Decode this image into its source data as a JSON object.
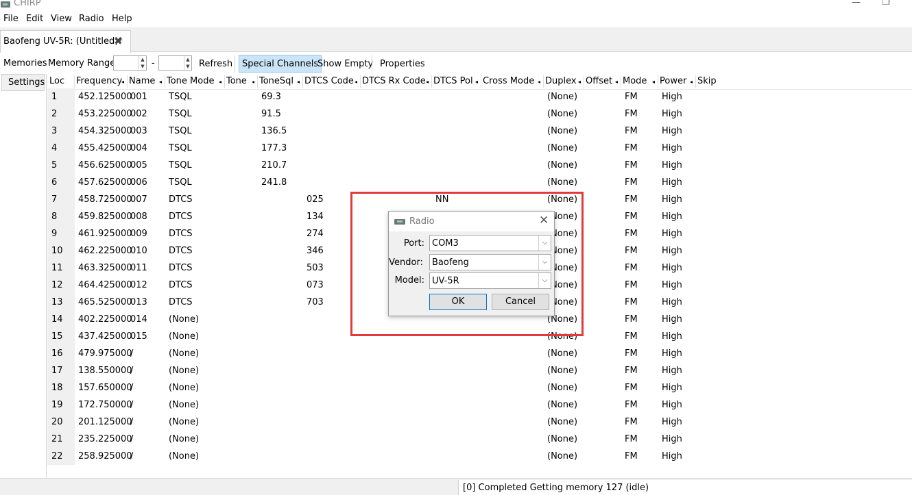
{
  "window": {
    "title": "CHIRP",
    "minimize_glyph": "—",
    "maximize_glyph": "❐"
  },
  "menu": [
    "File",
    "Edit",
    "View",
    "Radio",
    "Help"
  ],
  "tab": {
    "label": "Baofeng UV-5R: (Untitled)*",
    "close_glyph": "✖"
  },
  "toolbar": {
    "memories_label": "Memories",
    "range_label": "Memory Range:",
    "range_dash": "-",
    "range_from": "",
    "range_to": "",
    "refresh": "Refresh",
    "special_channels": "Special Channels",
    "show_empty": "Show Empty",
    "properties": "Properties"
  },
  "side_tab": "Settings",
  "columns": [
    "Loc",
    "Frequency",
    "Name",
    "Tone Mode",
    "Tone",
    "ToneSql",
    "DTCS Code",
    "DTCS Rx Code",
    "DTCS Pol",
    "Cross Mode",
    "Duplex",
    "Offset",
    "Mode",
    "Power",
    "Skip"
  ],
  "rows": [
    [
      "1",
      "452.125000",
      "001",
      "TSQL",
      "",
      "69.3",
      "",
      "",
      "",
      "",
      "(None)",
      "",
      "FM",
      "High",
      ""
    ],
    [
      "2",
      "453.225000",
      "002",
      "TSQL",
      "",
      "91.5",
      "",
      "",
      "",
      "",
      "(None)",
      "",
      "FM",
      "High",
      ""
    ],
    [
      "3",
      "454.325000",
      "003",
      "TSQL",
      "",
      "136.5",
      "",
      "",
      "",
      "",
      "(None)",
      "",
      "FM",
      "High",
      ""
    ],
    [
      "4",
      "455.425000",
      "004",
      "TSQL",
      "",
      "177.3",
      "",
      "",
      "",
      "",
      "(None)",
      "",
      "FM",
      "High",
      ""
    ],
    [
      "5",
      "456.625000",
      "005",
      "TSQL",
      "",
      "210.7",
      "",
      "",
      "",
      "",
      "(None)",
      "",
      "FM",
      "High",
      ""
    ],
    [
      "6",
      "457.625000",
      "006",
      "TSQL",
      "",
      "241.8",
      "",
      "",
      "",
      "",
      "(None)",
      "",
      "FM",
      "High",
      ""
    ],
    [
      "7",
      "458.725000",
      "007",
      "DTCS",
      "",
      "",
      "025",
      "",
      "NN",
      "",
      "(None)",
      "",
      "FM",
      "High",
      ""
    ],
    [
      "8",
      "459.825000",
      "008",
      "DTCS",
      "",
      "",
      "134",
      "",
      "",
      "",
      "(None)",
      "",
      "FM",
      "High",
      ""
    ],
    [
      "9",
      "461.925000",
      "009",
      "DTCS",
      "",
      "",
      "274",
      "",
      "",
      "",
      "(None)",
      "",
      "FM",
      "High",
      ""
    ],
    [
      "10",
      "462.225000",
      "010",
      "DTCS",
      "",
      "",
      "346",
      "",
      "",
      "",
      "(None)",
      "",
      "FM",
      "High",
      ""
    ],
    [
      "11",
      "463.325000",
      "011",
      "DTCS",
      "",
      "",
      "503",
      "",
      "",
      "",
      "(None)",
      "",
      "FM",
      "High",
      ""
    ],
    [
      "12",
      "464.425000",
      "012",
      "DTCS",
      "",
      "",
      "073",
      "",
      "",
      "",
      "(None)",
      "",
      "FM",
      "High",
      ""
    ],
    [
      "13",
      "465.525000",
      "013",
      "DTCS",
      "",
      "",
      "703",
      "",
      "",
      "",
      "(None)",
      "",
      "FM",
      "High",
      ""
    ],
    [
      "14",
      "402.225000",
      "014",
      "(None)",
      "",
      "",
      "",
      "",
      "",
      "",
      "(None)",
      "",
      "FM",
      "High",
      ""
    ],
    [
      "15",
      "437.425000",
      "015",
      "(None)",
      "",
      "",
      "",
      "",
      "",
      "",
      "(None)",
      "",
      "FM",
      "High",
      ""
    ],
    [
      "16",
      "479.975000",
      "/",
      "(None)",
      "",
      "",
      "",
      "",
      "",
      "",
      "(None)",
      "",
      "FM",
      "High",
      ""
    ],
    [
      "17",
      "138.550000",
      "/",
      "(None)",
      "",
      "",
      "",
      "",
      "",
      "",
      "(None)",
      "",
      "FM",
      "High",
      ""
    ],
    [
      "18",
      "157.650000",
      "/",
      "(None)",
      "",
      "",
      "",
      "",
      "",
      "",
      "(None)",
      "",
      "FM",
      "High",
      ""
    ],
    [
      "19",
      "172.750000",
      "/",
      "(None)",
      "",
      "",
      "",
      "",
      "",
      "",
      "(None)",
      "",
      "FM",
      "High",
      ""
    ],
    [
      "20",
      "201.125000",
      "/",
      "(None)",
      "",
      "",
      "",
      "",
      "",
      "",
      "(None)",
      "",
      "FM",
      "High",
      ""
    ],
    [
      "21",
      "235.225000",
      "/",
      "(None)",
      "",
      "",
      "",
      "",
      "",
      "",
      "(None)",
      "",
      "FM",
      "High",
      ""
    ],
    [
      "22",
      "258.925000",
      "/",
      "(None)",
      "",
      "",
      "",
      "",
      "",
      "",
      "(None)",
      "",
      "FM",
      "High",
      ""
    ]
  ],
  "status": "[0] Completed Getting memory 127 (idle)",
  "dialog": {
    "title": "Radio",
    "port_label": "Port:",
    "port_value": "COM3",
    "vendor_label": "Vendor:",
    "vendor_value": "Baofeng",
    "model_label": "Model:",
    "model_value": "UV-5R",
    "ok": "OK",
    "cancel": "Cancel"
  },
  "colors": {
    "highlight": "#e23a3a",
    "active_button": "#cce4f7"
  }
}
